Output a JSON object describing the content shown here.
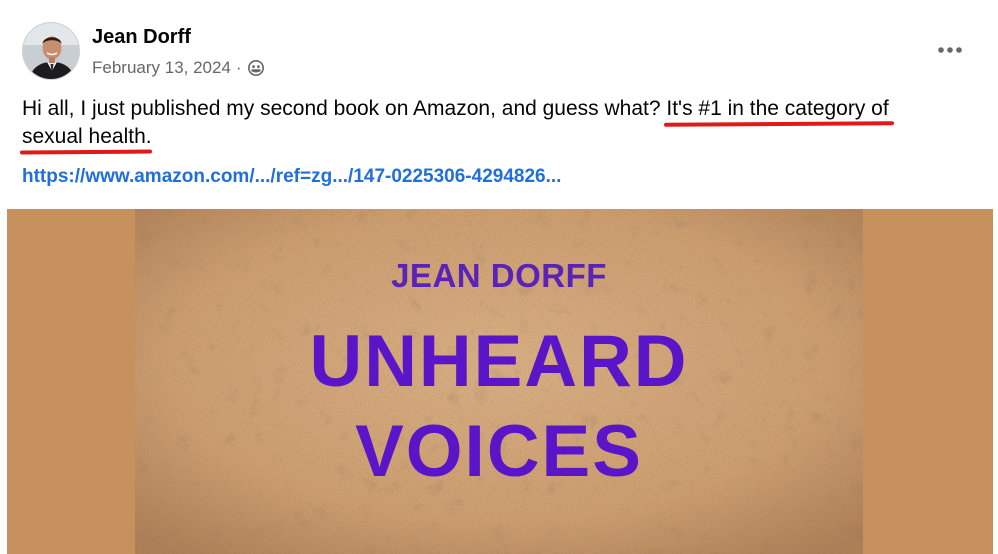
{
  "post": {
    "author_name": "Jean Dorff",
    "date": "February 13, 2024",
    "separator": "·",
    "privacy_icon": "friends-audience-icon",
    "more_icon": "more-options-icon",
    "text_before": "Hi all, I just published my second book on Amazon, and guess what? ",
    "text_highlight_1": "It's #1 in the category of",
    "text_highlight_2": "sexual health",
    "text_after": ".",
    "link": "https://www.amazon.com/.../ref=zg.../147-0225306-4294826...",
    "annotation_color": "#e11919",
    "link_color": "#216fdb"
  },
  "book_cover": {
    "author": "JEAN DORFF",
    "title_line_1": "UNHEARD",
    "title_line_2": "VOICES",
    "title_color": "#5a15c8",
    "background_color": "#c7915d"
  }
}
